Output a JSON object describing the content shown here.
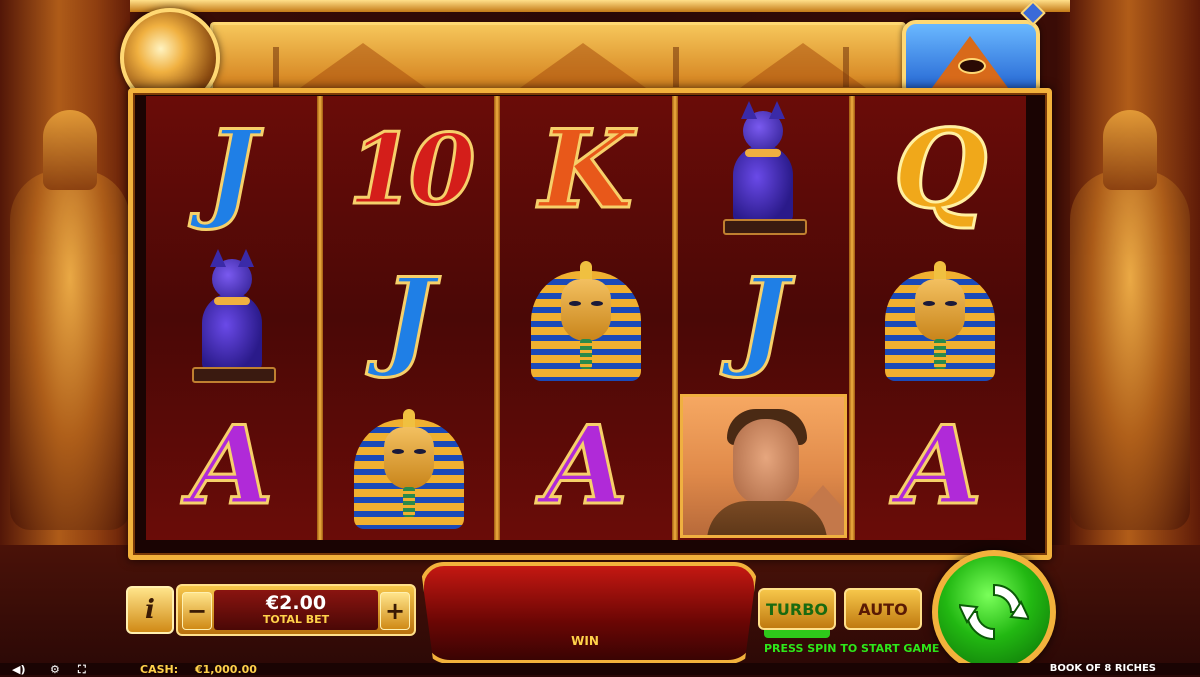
{
  "game": {
    "title": "BOOK OF 8 RICHES"
  },
  "reels": [
    [
      "J",
      "cat",
      "A"
    ],
    [
      "10",
      "J",
      "pharaoh"
    ],
    [
      "K",
      "pharaoh",
      "A"
    ],
    [
      "cat",
      "J",
      "explorer"
    ],
    [
      "Q",
      "pharaoh",
      "A"
    ]
  ],
  "controls": {
    "info_label": "i",
    "bet_minus": "−",
    "bet_plus": "+",
    "bet_value": "€2.00",
    "bet_label": "TOTAL BET",
    "win_label": "WIN",
    "turbo_label": "TURBO",
    "auto_label": "AUTO",
    "press_spin": "PRESS SPIN TO START GAME"
  },
  "status": {
    "cash_label": "CASH:",
    "cash_value": "€1,000.00",
    "sound_icon": "speaker-icon",
    "settings_icon": "gear-icon",
    "fullscreen_icon": "fullscreen-icon"
  },
  "colors": {
    "gold": "#f2b23c",
    "reel_red": "#6a0c08",
    "spin_green": "#22b812",
    "win_yellow": "#ffd24a"
  }
}
